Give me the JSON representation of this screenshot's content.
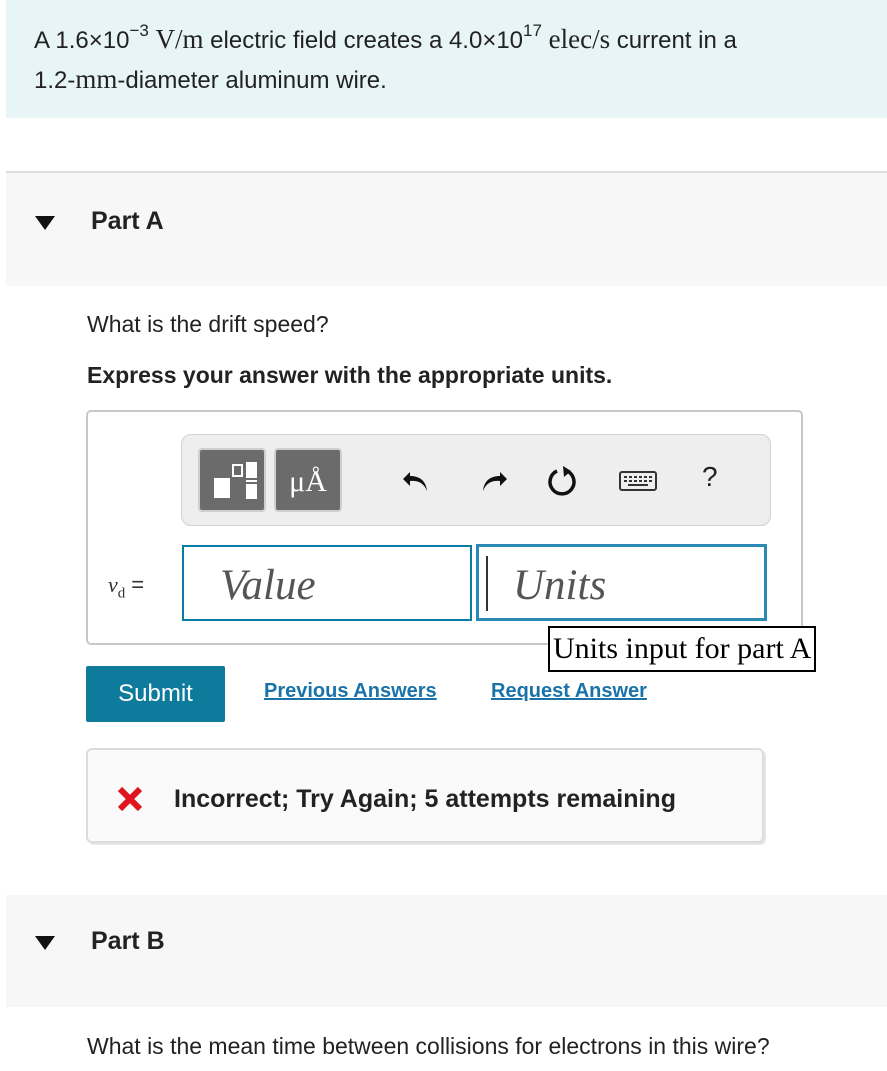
{
  "problem": {
    "prefix": "A 1.6×10",
    "field_exp": "−3",
    "field_unit": "V/m",
    "mid": " electric field creates a 4.0×10",
    "current_exp": "17",
    "current_unit": "elec/s",
    "suffix": " current in a",
    "line2_num": "1.2-",
    "line2_unit": "mm",
    "line2_rest": "-diameter aluminum wire."
  },
  "part_a": {
    "title": "Part A",
    "question": "What is the drift speed?",
    "instruction": "Express your answer with the appropriate units.",
    "toolbar": {
      "units_label": "μÅ",
      "help_label": "?"
    },
    "variable": "v",
    "variable_sub": "d",
    "equals": "=",
    "value_placeholder": "Value",
    "units_placeholder": "Units",
    "units_tooltip": "Units input for part A",
    "submit_label": "Submit",
    "previous_answers_label": "Previous Answers",
    "request_answer_label": "Request Answer",
    "feedback": "Incorrect; Try Again; 5 attempts remaining"
  },
  "part_b": {
    "title": "Part B",
    "question": "What is the mean time between collisions for electrons in this wire?"
  },
  "colors": {
    "accent": "#0e7b9d",
    "link": "#1a73a8",
    "error": "#e0141e",
    "problem_bg": "#e7f5f6"
  },
  "icons": [
    "templates-icon",
    "units-icon",
    "undo-icon",
    "redo-icon",
    "reset-icon",
    "keyboard-icon",
    "help-icon",
    "incorrect-x-icon",
    "collapse-triangle-icon"
  ]
}
